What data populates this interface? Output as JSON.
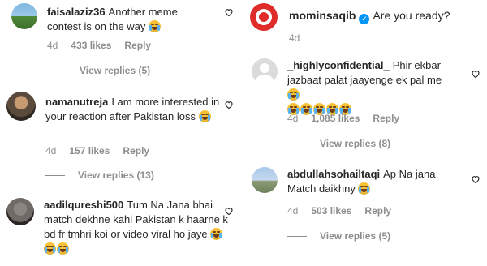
{
  "left": [
    {
      "username": "faisalaziz36",
      "text": "Another meme contest is on the way",
      "emojis": 1,
      "time": "4d",
      "likes": "433 likes",
      "reply": "Reply",
      "view_replies": "View replies (5)",
      "avatar_colors": [
        "#7fb8e0",
        "#4f8a3a"
      ]
    },
    {
      "username": "namanutreja",
      "text": "I am more interested in your reaction after Pakistan loss",
      "emojis": 1,
      "time": "4d",
      "likes": "157 likes",
      "reply": "Reply",
      "view_replies": "View replies (13)",
      "avatar_colors": [
        "#5a4a3c",
        "#c79a72"
      ]
    },
    {
      "username": "aadilqureshi500",
      "text": "Tum Na Jana bhai match dekhne kahi Pakistan k haarne k bd fr tmhri koi or video viral ho jaye",
      "emojis": 3,
      "time": "4d",
      "likes": "",
      "reply": "",
      "view_replies": "",
      "avatar_colors": [
        "#6f6a66",
        "#2b2623"
      ]
    }
  ],
  "right": [
    {
      "username": "mominsaqib",
      "verified": true,
      "text": "Are you ready?",
      "emojis": 0,
      "time": "4d",
      "likes": "",
      "reply": "",
      "view_replies": "",
      "avatar_colors": [
        "#e02b2b",
        "#ffffff"
      ]
    },
    {
      "username": "_highlyconfidential_",
      "text": "Phir ekbar jazbaat palat jaayenge ek pal me",
      "emojis": 6,
      "time": "4d",
      "likes": "1,085 likes",
      "reply": "Reply",
      "view_replies": "View replies (8)",
      "avatar_colors": [
        "#dbdbdb",
        "#ffffff"
      ]
    },
    {
      "username": "abdullahsohailtaqi",
      "text": "Ap Na jana Match daikhny",
      "emojis": 1,
      "time": "4d",
      "likes": "503 likes",
      "reply": "Reply",
      "view_replies": "View replies (5)",
      "avatar_colors": [
        "#a9c7e8",
        "#6b7f5a"
      ]
    }
  ]
}
